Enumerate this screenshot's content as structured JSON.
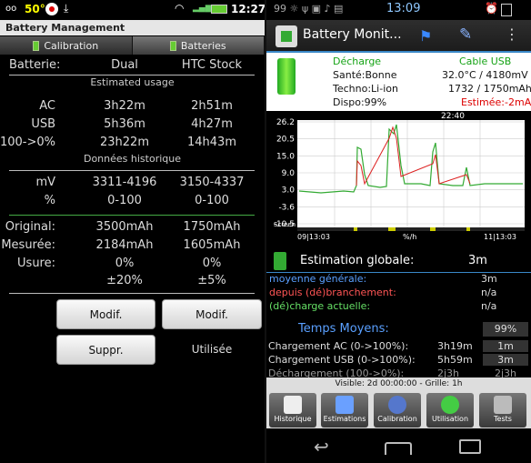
{
  "left": {
    "status": {
      "battery_pct": "50°",
      "time": "12:27"
    },
    "title": "Battery Management",
    "tabs": [
      {
        "label": "Calibration"
      },
      {
        "label": "Batteries"
      }
    ],
    "header_row": {
      "label": "Batterie:",
      "col1": "Dual",
      "col2": "HTC Stock"
    },
    "estimated_usage": "Estimated usage",
    "usage_rows": [
      {
        "label": "AC",
        "col1": "3h22m",
        "col2": "2h51m"
      },
      {
        "label": "USB",
        "col1": "5h36m",
        "col2": "4h27m"
      },
      {
        "label": "100->0%",
        "col1": "23h22m",
        "col2": "14h43m"
      }
    ],
    "history_title": "Données historique",
    "history_rows": [
      {
        "label": "mV",
        "col1": "3311-4196",
        "col2": "3150-4337"
      },
      {
        "label": "%",
        "col1": "0-100",
        "col2": "0-100"
      }
    ],
    "capacity_rows": [
      {
        "label": "Original:",
        "col1": "3500mAh",
        "col2": "1750mAh"
      },
      {
        "label": "Mesurée:",
        "col1": "2184mAh",
        "col2": "1605mAh"
      },
      {
        "label": "Usure:",
        "col1": "0%",
        "col2": "0%"
      },
      {
        "label": "",
        "col1": "±20%",
        "col2": "±5%"
      }
    ],
    "buttons": {
      "modif1": "Modif.",
      "modif2": "Modif.",
      "suppr": "Suppr.",
      "utilisee": "Utilisée"
    }
  },
  "right": {
    "status": {
      "time": "13:09"
    },
    "app_title": "Battery Monit...",
    "info": {
      "state": "Décharge",
      "source": "Cable USB",
      "health": "Santé:Bonne",
      "temp_voltage": "32.0°C / 4180mV",
      "techno": "Techno:Li-ion",
      "capacity": "1732 / 1750mAh",
      "dispo": "Dispo:99%",
      "estimee": "Estimée:-2mA"
    },
    "chart_data": {
      "type": "line",
      "y_ticks": [
        "26.2",
        "20.5",
        "15.0",
        "9.0",
        "3.0",
        "-3.6",
        "-10.5"
      ],
      "top_label": "22:40",
      "screen_label": "Screen",
      "x_start": "09|13:03",
      "x_mid": "%/h",
      "x_end": "11|13:03",
      "ylim": [
        -10.5,
        26.2
      ]
    },
    "estimation": {
      "label": "Estimation globale:",
      "value": "3m"
    },
    "averages": [
      {
        "label": "moyenne générale:",
        "value": "3m",
        "color": "#5aa0ff"
      },
      {
        "label": "depuis (dé)branchement:",
        "value": "n/a",
        "color": "#ff5555"
      },
      {
        "label": "(dé)charge actuelle:",
        "value": "n/a",
        "color": "#66e066"
      }
    ],
    "temps_moyens": {
      "label": "Temps Moyens:",
      "value": "99%"
    },
    "charge_rows": [
      {
        "label": "Chargement AC (0->100%):",
        "v1": "3h19m",
        "v2": "1m"
      },
      {
        "label": "Chargement USB (0->100%):",
        "v1": "5h59m",
        "v2": "3m"
      },
      {
        "label": "Déchargement (100->0%):",
        "v1": "2j3h",
        "v2": "2j3h"
      }
    ],
    "visible_line": "Visible: 2d 00:00:00 - Grille: 1h",
    "bottom_buttons": [
      {
        "label": "Historique"
      },
      {
        "label": "Estimations"
      },
      {
        "label": "Calibration"
      },
      {
        "label": "Utilisation"
      },
      {
        "label": "Tests"
      }
    ]
  }
}
